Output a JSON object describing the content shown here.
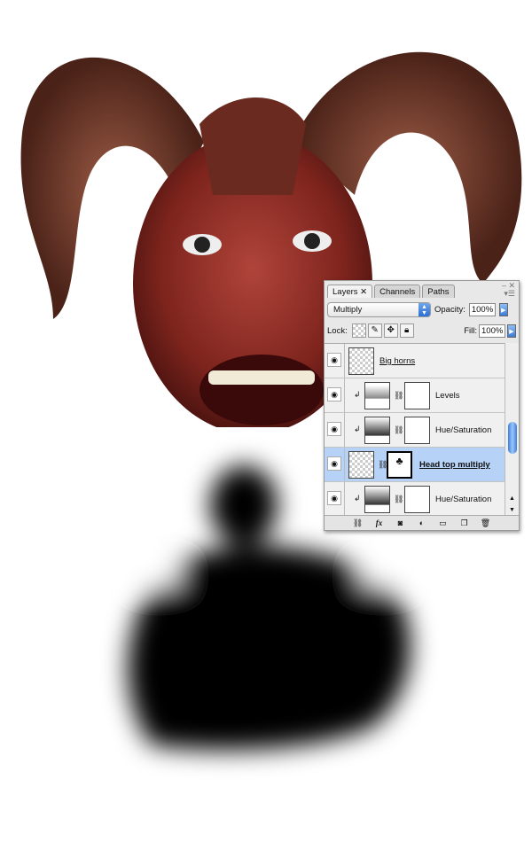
{
  "panel": {
    "tabs": [
      "Layers",
      "Channels",
      "Paths"
    ],
    "blend_mode": "Multiply",
    "opacity_label": "Opacity:",
    "opacity": "100%",
    "lock_label": "Lock:",
    "fill_label": "Fill:",
    "fill": "100%",
    "layers": [
      {
        "name": "Big horns",
        "type": "pixel",
        "selected": false
      },
      {
        "name": "Levels",
        "type": "adjustment",
        "selected": false
      },
      {
        "name": "Hue/Saturation",
        "type": "adjustment",
        "selected": false
      },
      {
        "name": "Head top multiply",
        "type": "pixel-mask",
        "selected": true
      },
      {
        "name": "Hue/Saturation",
        "type": "adjustment",
        "selected": false
      }
    ],
    "bottom_icons": [
      "link-icon",
      "fx-icon",
      "mask-icon",
      "adjustment-icon",
      "folder-icon",
      "new-layer-icon",
      "trash-icon"
    ],
    "fx_label": "fx"
  },
  "colors": {
    "selection": "#b7d2f7",
    "accent": "#2a6ed6",
    "skin": "#8a2a22"
  }
}
